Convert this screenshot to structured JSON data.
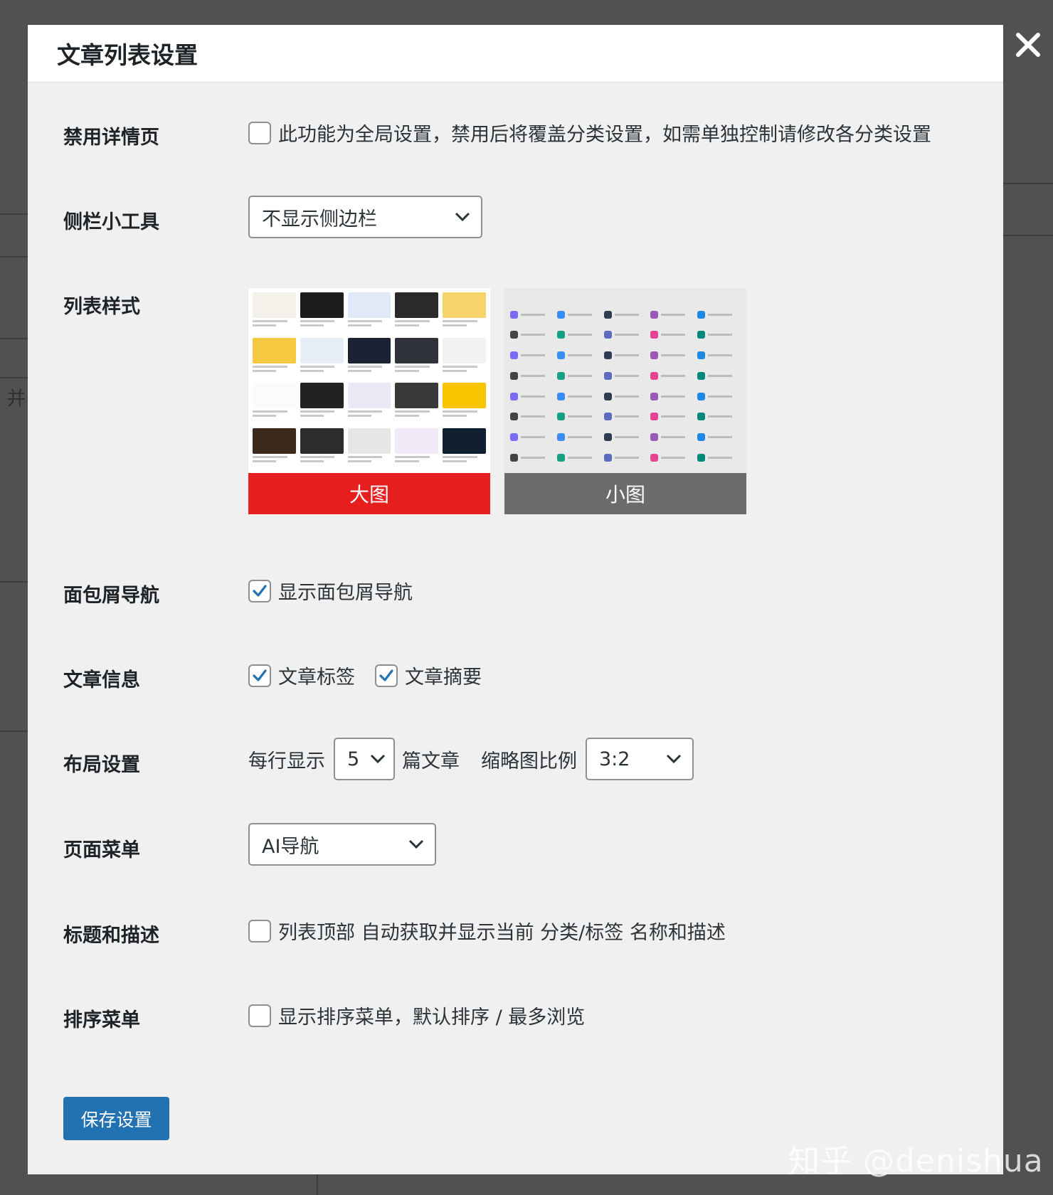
{
  "dialog": {
    "title": "文章列表设置",
    "close_glyph": "✕"
  },
  "background": {
    "side_char": "并"
  },
  "settings": {
    "disable_detail": {
      "label": "禁用详情页",
      "checked": false,
      "text": "此功能为全局设置，禁用后将覆盖分类设置，如需单独控制请修改各分类设置"
    },
    "sidebar": {
      "label": "侧栏小工具",
      "value": "不显示侧边栏"
    },
    "list_style": {
      "label": "列表样式",
      "options": [
        {
          "label": "大图",
          "selected": true,
          "bar_color": "#e61e1e"
        },
        {
          "label": "小图",
          "selected": false,
          "bar_color": "#6b6b6b"
        }
      ]
    },
    "breadcrumb": {
      "label": "面包屑导航",
      "checked": true,
      "text": "显示面包屑导航"
    },
    "post_info": {
      "label": "文章信息",
      "items": [
        {
          "text": "文章标签",
          "checked": true
        },
        {
          "text": "文章摘要",
          "checked": true
        }
      ]
    },
    "layout": {
      "label": "布局设置",
      "per_row_prefix": "每行显示",
      "per_row_value": "5",
      "per_row_suffix": "篇文章",
      "ratio_label": "缩略图比例",
      "ratio_value": "3:2"
    },
    "page_menu": {
      "label": "页面菜单",
      "value": "AI导航"
    },
    "title_desc": {
      "label": "标题和描述",
      "checked": false,
      "text": "列表顶部 自动获取并显示当前 分类/标签 名称和描述"
    },
    "sort_menu": {
      "label": "排序菜单",
      "checked": false,
      "text": "显示排序菜单，默认排序 / 最多浏览"
    }
  },
  "save_button": "保存设置",
  "watermark": "知乎 @denishua",
  "colors": {
    "primary": "#2271b1",
    "checkbox_check": "#2271b1",
    "selected_style": "#e61e1e",
    "unselected_style": "#6b6b6b"
  },
  "icons": [
    "close-icon",
    "chevron-down-icon",
    "check-icon"
  ]
}
